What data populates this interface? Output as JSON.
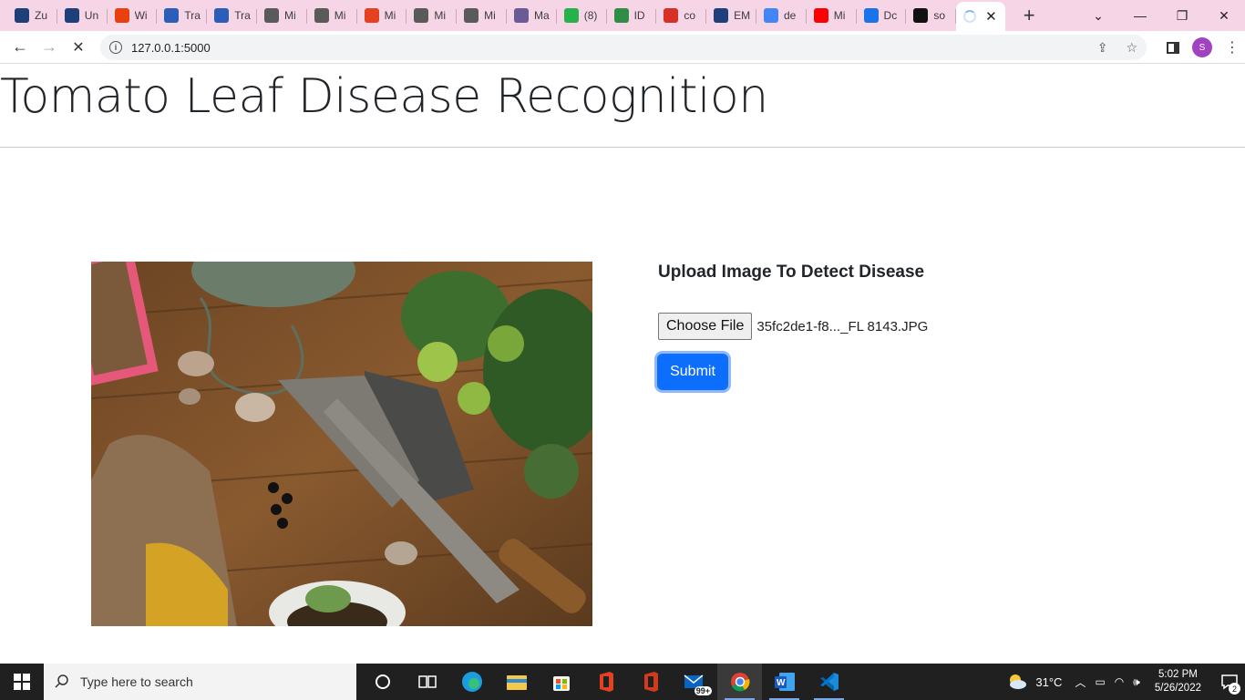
{
  "browser": {
    "tabs": [
      {
        "label": "Zu",
        "icon": "unima-icon",
        "color": "#1d3f7a"
      },
      {
        "label": "Un",
        "icon": "unima-icon",
        "color": "#1d3f7a"
      },
      {
        "label": "Wi",
        "icon": "alert-icon",
        "color": "#e8410e"
      },
      {
        "label": "Tra",
        "icon": "word-icon",
        "color": "#2b5eb8"
      },
      {
        "label": "Tra",
        "icon": "word-icon",
        "color": "#2b5eb8"
      },
      {
        "label": "Mi",
        "icon": "globe-icon",
        "color": "#5a5a5a"
      },
      {
        "label": "Mi",
        "icon": "globe-icon",
        "color": "#5a5a5a"
      },
      {
        "label": "Mi",
        "icon": "office-icon",
        "color": "#e3411f"
      },
      {
        "label": "Mi",
        "icon": "globe-icon",
        "color": "#5a5a5a"
      },
      {
        "label": "Mi",
        "icon": "globe-icon",
        "color": "#5a5a5a"
      },
      {
        "label": "Ma",
        "icon": "shield-icon",
        "color": "#6b5b95"
      },
      {
        "label": "(8)",
        "icon": "badge-icon",
        "color": "#25b24a"
      },
      {
        "label": "ID",
        "icon": "geeks-icon",
        "color": "#2f8d46"
      },
      {
        "label": "co",
        "icon": "gmail-icon",
        "color": "#d93025"
      },
      {
        "label": "EM",
        "icon": "unima-icon",
        "color": "#1d3f7a"
      },
      {
        "label": "de",
        "icon": "google-icon",
        "color": "#4285f4"
      },
      {
        "label": "Mi",
        "icon": "youtube-icon",
        "color": "#ff0000"
      },
      {
        "label": "Dc",
        "icon": "download-icon",
        "color": "#1a73e8"
      },
      {
        "label": "so",
        "icon": "github-icon",
        "color": "#111111"
      }
    ],
    "url": "127.0.0.1:5000"
  },
  "page": {
    "title": "Tomato Leaf Disease Recognition",
    "upload_heading": "Upload Image To Detect Disease",
    "choose_file_label": "Choose File",
    "file_name": "35fc2de1-f8..._FL 8143.JPG",
    "submit_label": "Submit"
  },
  "taskbar": {
    "search_placeholder": "Type here to search",
    "mail_badge": "99+",
    "temperature": "31°C",
    "time": "5:02 PM",
    "date": "5/26/2022",
    "notification_count": "2"
  },
  "colors": {
    "accent": "#0d6efd",
    "tabstrip": "#f6d5e6",
    "taskbar": "#202020"
  }
}
